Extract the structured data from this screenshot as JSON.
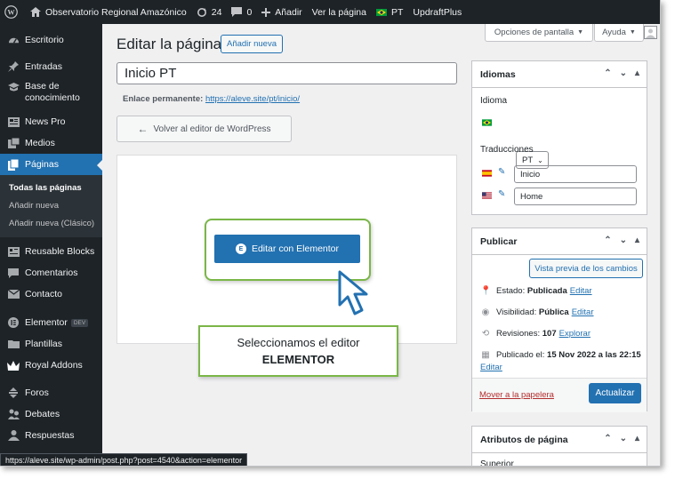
{
  "adminbar": {
    "site_name": "Observatorio Regional Amazónico",
    "updates_count": "24",
    "comments_count": "0",
    "add_label": "Añadir",
    "view_page": "Ver la página",
    "lang": "PT",
    "plugin": "UpdraftPlus"
  },
  "sidebar": {
    "items": [
      {
        "label": "Escritorio",
        "icon": "dashboard-icon"
      },
      {
        "label": "Entradas",
        "icon": "pin-icon"
      },
      {
        "label": "Base de conocimiento",
        "icon": "knowledge-icon"
      },
      {
        "label": "News Pro",
        "icon": "news-icon"
      },
      {
        "label": "Medios",
        "icon": "media-icon"
      },
      {
        "label": "Páginas",
        "icon": "pages-icon"
      },
      {
        "label": "Reusable Blocks",
        "icon": "blocks-icon"
      },
      {
        "label": "Comentarios",
        "icon": "comment-icon"
      },
      {
        "label": "Contacto",
        "icon": "mail-icon"
      },
      {
        "label": "Elementor",
        "icon": "elementor-icon",
        "badge": "DEV"
      },
      {
        "label": "Plantillas",
        "icon": "folder-icon"
      },
      {
        "label": "Royal Addons",
        "icon": "crown-icon"
      },
      {
        "label": "Foros",
        "icon": "forum-icon"
      },
      {
        "label": "Debates",
        "icon": "debates-icon"
      },
      {
        "label": "Respuestas",
        "icon": "replies-icon"
      }
    ],
    "submenu": [
      "Todas las páginas",
      "Añadir nueva",
      "Añadir nueva (Clásico)"
    ]
  },
  "screen_options": "Opciones de pantalla",
  "help": "Ayuda",
  "page": {
    "heading": "Editar la página",
    "add_new": "Añadir nueva",
    "title_value": "Inicio PT",
    "permalink_label": "Enlace permanente:",
    "permalink_url": "https://aleve.site/pt/inicio/",
    "back_button": "Volver al editor de WordPress",
    "elementor_button": "Editar con Elementor",
    "callout_line1": "Seleccionamos el editor",
    "callout_line2": "ELEMENTOR"
  },
  "idiomas": {
    "title": "Idiomas",
    "language_label": "Idioma",
    "language_value": "PT",
    "translations_label": "Traducciones",
    "translation_es": "Inicio",
    "translation_en": "Home"
  },
  "publicar": {
    "title": "Publicar",
    "preview_button": "Vista previa de los cambios",
    "status_label": "Estado:",
    "status_value": "Publicada",
    "visibility_label": "Visibilidad:",
    "visibility_value": "Pública",
    "revisions_label": "Revisiones:",
    "revisions_value": "107",
    "revisions_link": "Explorar",
    "published_label": "Publicado el:",
    "published_value": "15 Nov 2022 a las 22:15",
    "edit_link": "Editar",
    "trash_link": "Mover a la papelera",
    "update_button": "Actualizar"
  },
  "atributos": {
    "title": "Atributos de página",
    "parent_label": "Superior"
  },
  "status_url": "https://aleve.site/wp-admin/post.php?post=4540&action=elementor",
  "colors": {
    "accent": "#2271b1",
    "callout_border": "#7ab648",
    "admin_dark": "#1d2327"
  }
}
